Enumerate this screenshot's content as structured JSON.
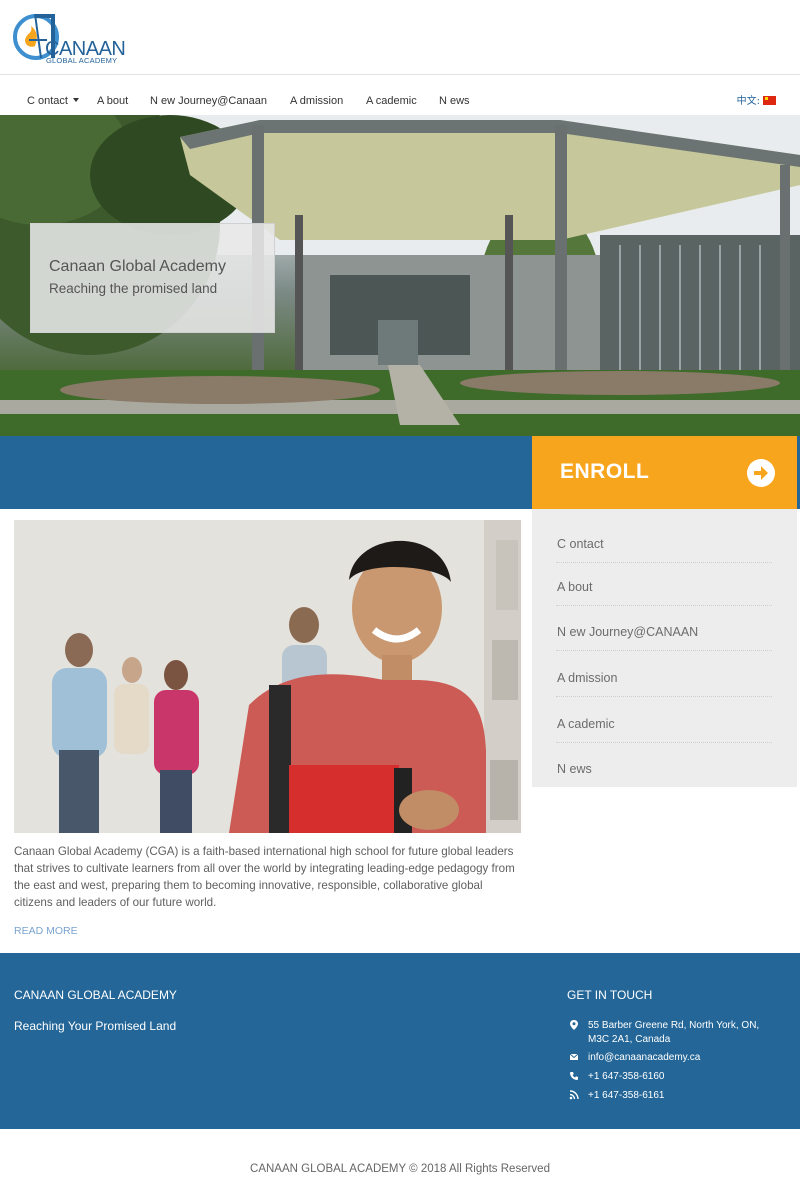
{
  "brand": {
    "name": "CANAAN",
    "subtitle": "GLOBAL ACADEMY"
  },
  "nav": {
    "items": [
      {
        "label": "C ontact",
        "has_dropdown": true
      },
      {
        "label": "A bout"
      },
      {
        "label": "N ew Journey@Canaan"
      },
      {
        "label": "A dmission"
      },
      {
        "label": "A cademic"
      },
      {
        "label": "N ews"
      }
    ],
    "language": "中文:"
  },
  "hero": {
    "title": "Canaan Global Academy",
    "subtitle": "Reaching the promised land"
  },
  "enroll": {
    "label": "ENROLL"
  },
  "sidebar": {
    "items": [
      {
        "label": "C ontact"
      },
      {
        "label": "A bout"
      },
      {
        "label": "N ew Journey@CANAAN"
      },
      {
        "label": "A dmission"
      },
      {
        "label": "A cademic"
      },
      {
        "label": "N ews"
      }
    ]
  },
  "main": {
    "description": "Canaan Global Academy (CGA) is a faith-based international high school for future global leaders that strives to cultivate learners from all over the world by integrating leading-edge pedagogy from the east and west, preparing them to becoming innovative, responsible, collaborative global citizens and leaders of our future world.",
    "read_more": "READ MORE"
  },
  "footer": {
    "title": "CANAAN GLOBAL ACADEMY",
    "tagline": "Reaching Your Promised Land",
    "contact_heading": "GET IN TOUCH",
    "address_line1": "55 Barber Greene Rd, North York, ON,",
    "address_line2": "M3C 2A1, Canada",
    "email": "info@canaanacademy.ca",
    "phone": "+1 647-358-6160",
    "fax": "+1 647-358-6161",
    "copyright": "CANAAN GLOBAL ACADEMY © 2018 All Rights Reserved"
  },
  "colors": {
    "primary": "#236697",
    "accent": "#f7a51c",
    "sidebar_bg": "#ededed"
  }
}
